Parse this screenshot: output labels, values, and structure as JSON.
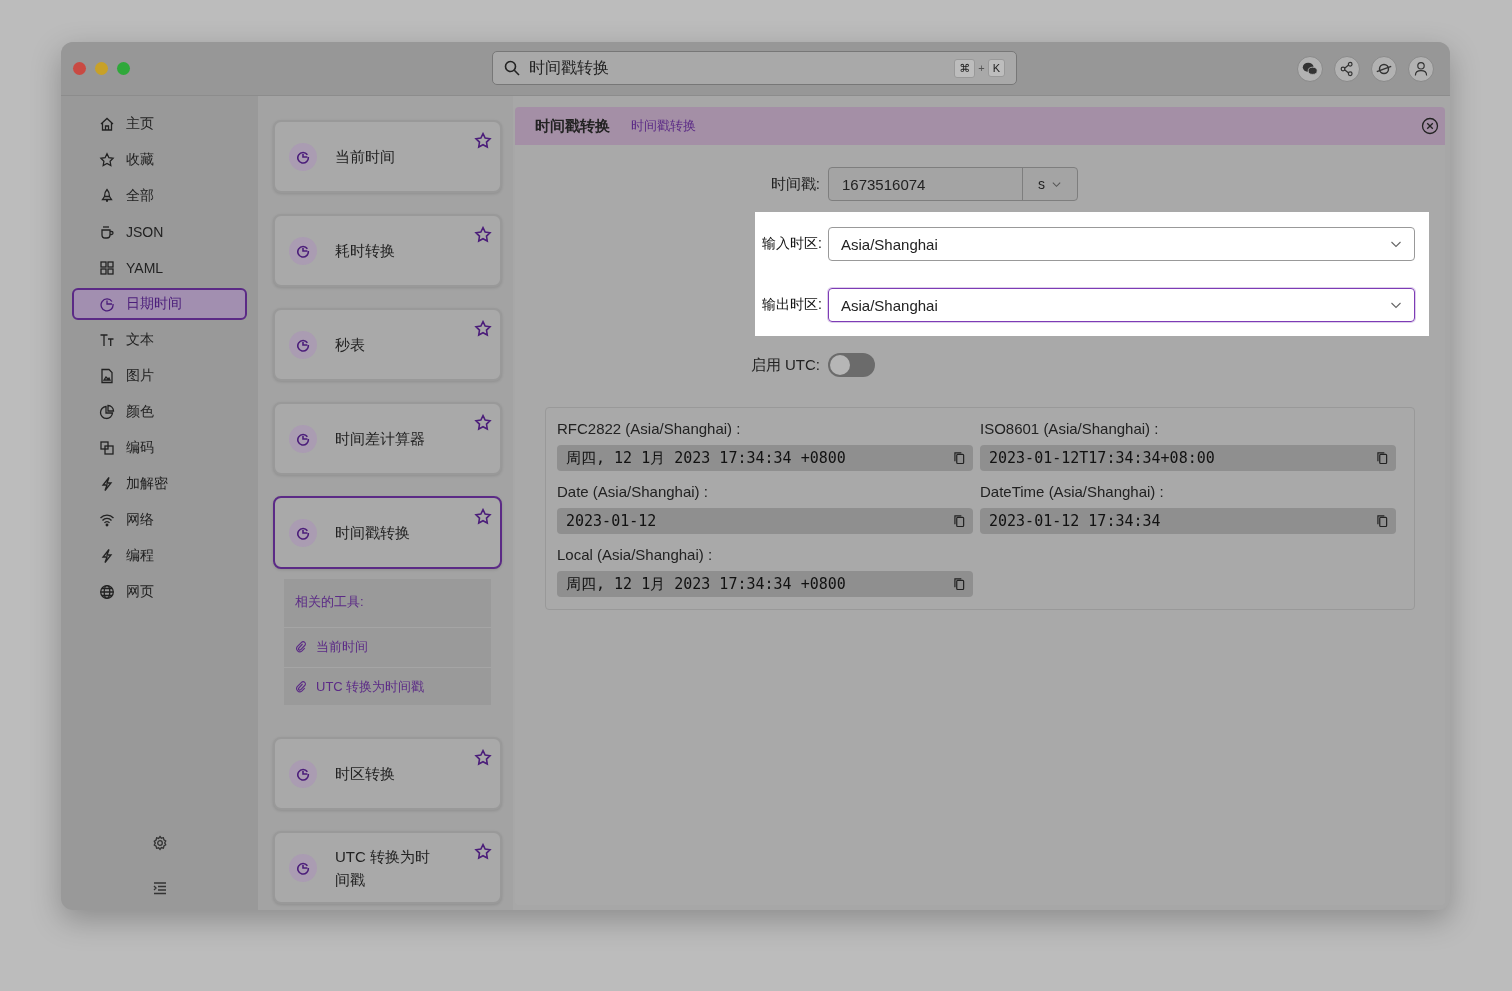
{
  "search": {
    "value": "时间戳转换",
    "shortcut": [
      "⌘",
      "+",
      "K"
    ]
  },
  "sidebar": {
    "items": [
      {
        "kind": "home",
        "label": "主页",
        "selected": false
      },
      {
        "kind": "star",
        "label": "收藏",
        "selected": false
      },
      {
        "kind": "rocket",
        "label": "全部",
        "selected": false
      },
      {
        "kind": "cup",
        "label": "JSON",
        "selected": false
      },
      {
        "kind": "grid",
        "label": "YAML",
        "selected": false
      },
      {
        "kind": "clock",
        "label": "日期时间",
        "selected": true
      },
      {
        "kind": "text",
        "label": "文本",
        "selected": false
      },
      {
        "kind": "image",
        "label": "图片",
        "selected": false
      },
      {
        "kind": "pie",
        "label": "颜色",
        "selected": false
      },
      {
        "kind": "copy",
        "label": "编码",
        "selected": false
      },
      {
        "kind": "bolt",
        "label": "加解密",
        "selected": false
      },
      {
        "kind": "wifi",
        "label": "网络",
        "selected": false
      },
      {
        "kind": "bolt",
        "label": "编程",
        "selected": false
      },
      {
        "kind": "globe",
        "label": "网页",
        "selected": false
      }
    ]
  },
  "tools": [
    {
      "title": "当前时间",
      "selected": false
    },
    {
      "title": "耗时转换",
      "selected": false
    },
    {
      "title": "秒表",
      "selected": false
    },
    {
      "title": "时间差计算器",
      "selected": false
    },
    {
      "title": "时间戳转换",
      "selected": true,
      "related": {
        "title": "相关的工具:",
        "links": [
          "当前时间",
          "UTC 转换为时间戳"
        ]
      }
    },
    {
      "title": "时区转换",
      "selected": false
    },
    {
      "title": "UTC 转换为时间戳",
      "selected": false
    }
  ],
  "header": {
    "title": "时间戳转换",
    "breadcrumb": "时间戳转换"
  },
  "form": {
    "timestamp": {
      "label": "时间戳:",
      "value": "1673516074",
      "unit": "s"
    },
    "zones": [
      {
        "label": "输入时区:",
        "value": "Asia/Shanghai",
        "focused": false
      },
      {
        "label": "输出时区:",
        "value": "Asia/Shanghai",
        "focused": true
      }
    ],
    "utc": {
      "label": "启用 UTC:",
      "on": false
    }
  },
  "results": [
    {
      "label": "RFC2822 (Asia/Shanghai) :",
      "value": "周四, 12 1月 2023 17:34:34 +0800"
    },
    {
      "label": "ISO8601 (Asia/Shanghai) :",
      "value": "2023-01-12T17:34:34+08:00"
    },
    {
      "label": "Date (Asia/Shanghai) :",
      "value": "2023-01-12"
    },
    {
      "label": "DateTime (Asia/Shanghai) :",
      "value": "2023-01-12 17:34:34"
    },
    {
      "label": "Local (Asia/Shanghai) :",
      "value": "周四, 12 1月 2023 17:34:34 +0800"
    }
  ]
}
